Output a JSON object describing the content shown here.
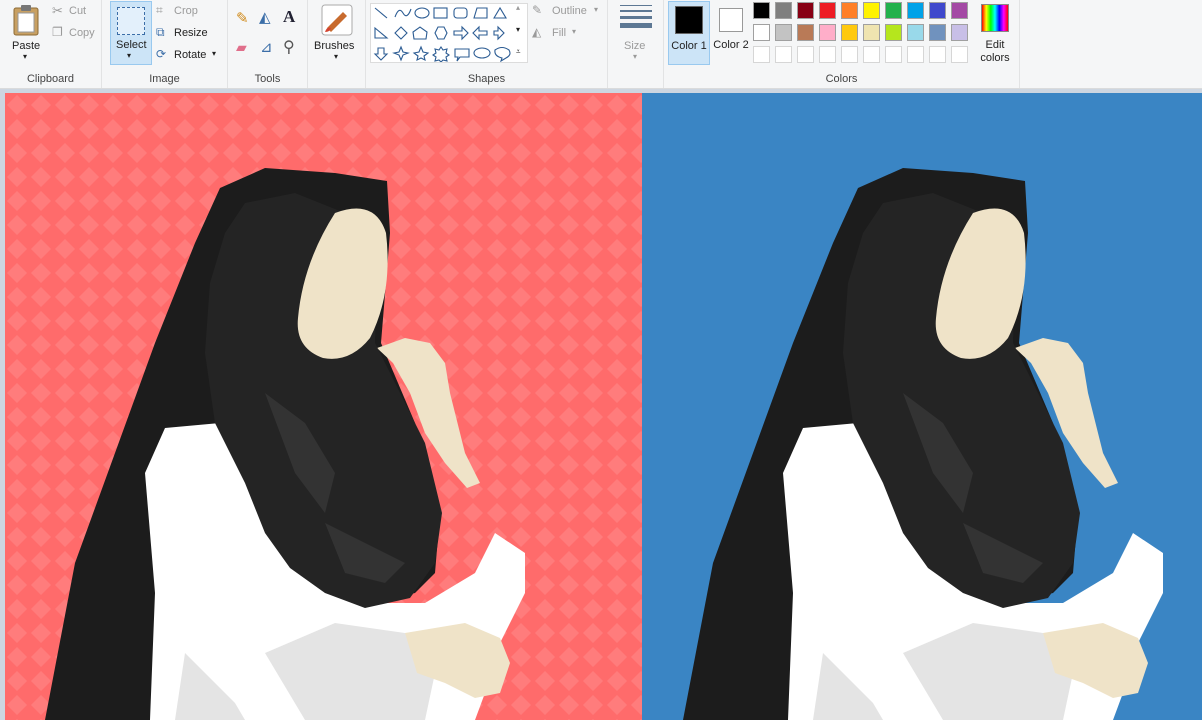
{
  "clipboard": {
    "paste": "Paste",
    "cut": "Cut",
    "copy": "Copy",
    "group": "Clipboard"
  },
  "image": {
    "select": "Select",
    "crop": "Crop",
    "resize": "Resize",
    "rotate": "Rotate",
    "group": "Image"
  },
  "tools": {
    "group": "Tools"
  },
  "brushes": {
    "label": "Brushes"
  },
  "shapes": {
    "outline": "Outline",
    "fill": "Fill",
    "group": "Shapes"
  },
  "size": {
    "label": "Size"
  },
  "colors": {
    "color1": "Color 1",
    "color2": "Color 2",
    "edit": "Edit colors",
    "group": "Colors",
    "color1_value": "#000000",
    "color2_value": "#ffffff",
    "palette_row1": [
      "#000000",
      "#7f7f7f",
      "#880015",
      "#ed1c24",
      "#ff7f27",
      "#fff200",
      "#22b14c",
      "#00a2e8",
      "#3f48cc",
      "#a349a4"
    ],
    "palette_row2": [
      "#ffffff",
      "#c3c3c3",
      "#b97a57",
      "#ffaec9",
      "#ffc90e",
      "#efe4b0",
      "#b5e61d",
      "#99d9ea",
      "#7092be",
      "#c8bfe7"
    ]
  },
  "canvas": {
    "left_bg": "#ff6b6b",
    "right_bg": "#3a85c4"
  }
}
